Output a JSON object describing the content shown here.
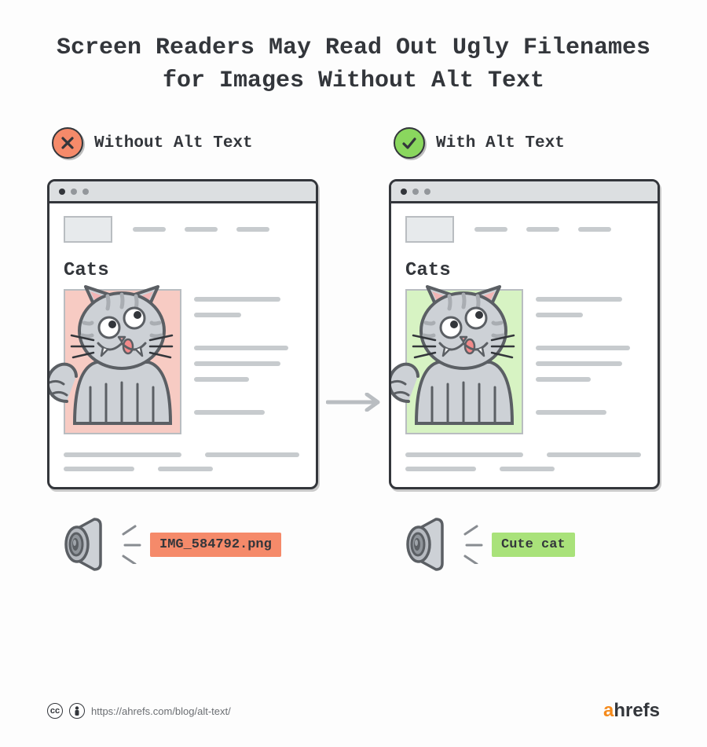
{
  "title": "Screen Readers May Read Out Ugly Filenames for Images Without Alt Text",
  "left": {
    "label": "Without Alt Text",
    "page_title": "Cats",
    "speaker_output": "IMG_584792.png"
  },
  "right": {
    "label": "With Alt Text",
    "page_title": "Cats",
    "speaker_output": "Cute cat"
  },
  "footer": {
    "url": "https://ahrefs.com/blog/alt-text/",
    "brand": "ahrefs"
  }
}
